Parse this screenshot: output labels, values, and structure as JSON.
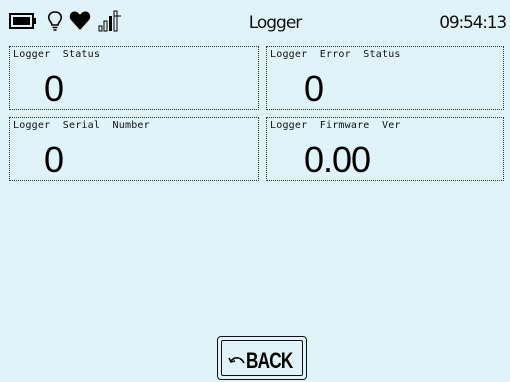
{
  "status_bar": {
    "title": "Logger",
    "time": "09:54:13",
    "icons": [
      "battery-icon",
      "bulb-icon",
      "heart-icon",
      "signal-icon"
    ]
  },
  "panels": [
    {
      "label": "Logger  Status",
      "value": "0"
    },
    {
      "label": "Logger  Error  Status",
      "value": "0"
    },
    {
      "label": "Logger  Serial  Number",
      "value": "0"
    },
    {
      "label": "Logger  Firmware  Ver",
      "value": "0.00"
    }
  ],
  "back_button": {
    "label": "BACK"
  },
  "colors": {
    "background": "#dff3f9",
    "text": "#000000"
  }
}
